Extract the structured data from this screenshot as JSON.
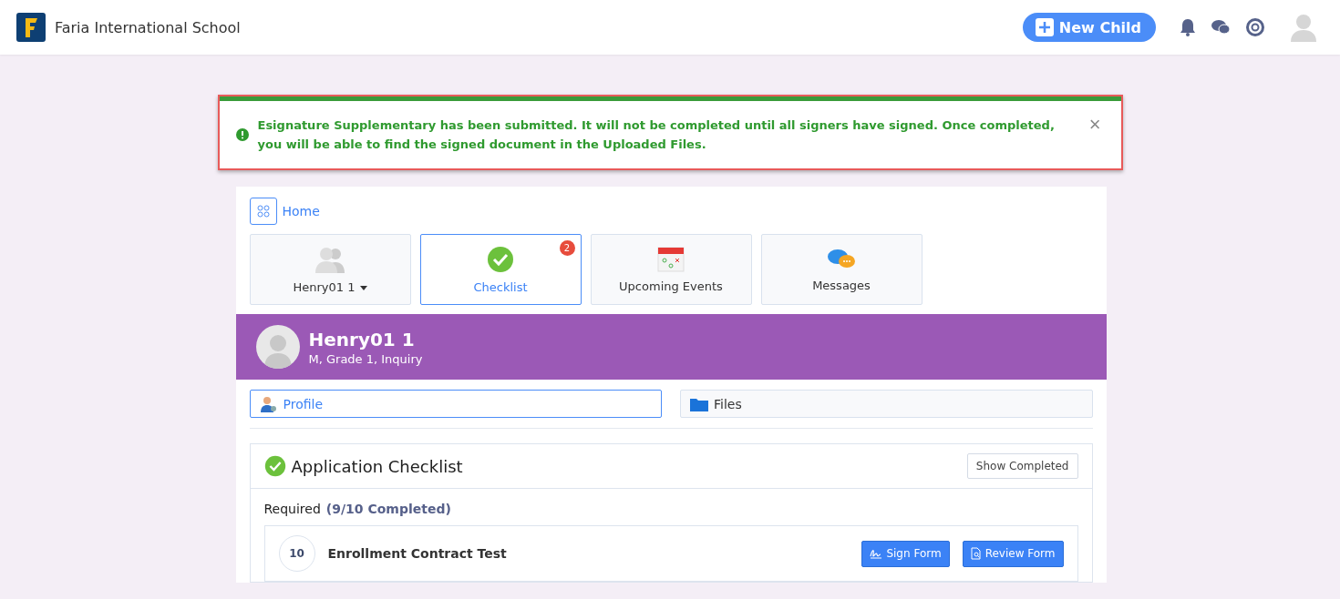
{
  "header": {
    "school": "Faria International School",
    "new_child_button": "New Child"
  },
  "alert": {
    "message": "Esignature Supplementary has been submitted. It will not be completed until all signers have signed. Once completed, you will be able to find the signed document in the Uploaded Files.",
    "close": "×"
  },
  "breadcrumb": {
    "label": "Home"
  },
  "tiles": [
    {
      "kind": "child",
      "label": "Henry01 1",
      "selected": false
    },
    {
      "kind": "checklist",
      "label": "Checklist",
      "selected": true,
      "badge": "2"
    },
    {
      "kind": "events",
      "label": "Upcoming Events",
      "selected": false
    },
    {
      "kind": "messages",
      "label": "Messages",
      "selected": false
    }
  ],
  "student": {
    "name": "Henry01 1",
    "details": "M, Grade 1, Inquiry"
  },
  "tabs": [
    {
      "kind": "profile",
      "label": "Profile",
      "selected": true
    },
    {
      "kind": "files",
      "label": "Files",
      "selected": false
    }
  ],
  "checklist": {
    "title": "Application Checklist",
    "show_completed_button": "Show Completed",
    "section": "Required",
    "progress": "(9/10 Completed)",
    "items": [
      {
        "number": "10",
        "name": "Enrollment Contract Test",
        "buttons": [
          {
            "kind": "sign",
            "label": "Sign Form"
          },
          {
            "kind": "review",
            "label": "Review Form"
          }
        ]
      }
    ]
  }
}
